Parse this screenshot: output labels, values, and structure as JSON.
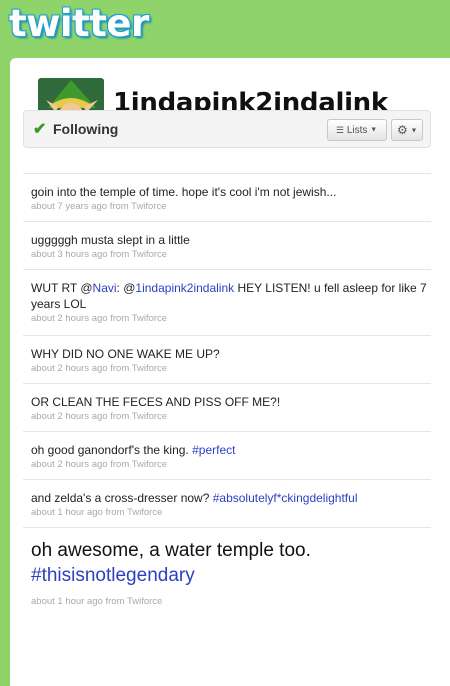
{
  "logo": "twitter",
  "profile": {
    "screen_name": "1indapink2indalink",
    "avatar_icon": "link-avatar"
  },
  "follow_bar": {
    "status": "Following",
    "lists_label": "Lists",
    "gear_icon": "gear-icon"
  },
  "tweets": [
    {
      "parts": [
        {
          "text": "goin into the temple of time. hope it's cool i'm not jewish..."
        }
      ],
      "meta": "about 7 years ago from Twiforce"
    },
    {
      "parts": [
        {
          "text": "ugggggh musta slept in a little"
        }
      ],
      "meta": "about 3 hours ago from Twiforce"
    },
    {
      "parts": [
        {
          "text": "WUT RT @"
        },
        {
          "text": "Navi",
          "link": true
        },
        {
          "text": ":  @"
        },
        {
          "text": "1indapink2indalink",
          "link": true
        },
        {
          "text": " HEY LISTEN! u fell asleep for like 7 years LOL"
        }
      ],
      "meta": "about 2 hours ago from Twiforce"
    },
    {
      "parts": [
        {
          "text": "WHY DID NO ONE WAKE ME UP?"
        }
      ],
      "meta": "about 2 hours ago from Twiforce"
    },
    {
      "parts": [
        {
          "text": "OR CLEAN THE FECES AND PISS OFF ME?!"
        }
      ],
      "meta": "about 2 hours ago from Twiforce"
    },
    {
      "parts": [
        {
          "text": "oh good ganondorf's the king. "
        },
        {
          "text": "#perfect",
          "link": true
        }
      ],
      "meta": "about 2 hours ago from Twiforce"
    },
    {
      "parts": [
        {
          "text": "and zelda's a cross-dresser now? "
        },
        {
          "text": "#absolutelyf*ckingdelightful",
          "link": true
        }
      ],
      "meta": "about 1 hour ago from Twiforce"
    },
    {
      "parts": [
        {
          "text": "oh awesome, a water temple too. "
        },
        {
          "text": "#thisisnotlegendary",
          "link": true
        }
      ],
      "meta": "about 1 hour ago from Twiforce",
      "big": true
    }
  ],
  "colors": {
    "link": "#2c3fc1",
    "background": "#8fd46a",
    "logo": "#1ea0d8"
  }
}
